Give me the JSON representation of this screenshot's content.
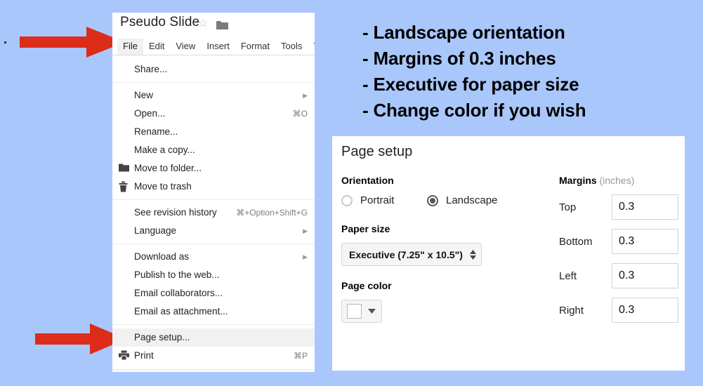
{
  "slide": {
    "background_color": "#aac7fc",
    "arrow_color": "#dd2c1a"
  },
  "instructions": {
    "lines": [
      "- Landscape orientation",
      "- Margins of 0.3 inches",
      "- Executive for paper size",
      "- Change color if you wish"
    ]
  },
  "docs_window": {
    "doc_title": "Pseudo Slide",
    "menubar": [
      {
        "label": "File",
        "active": true
      },
      {
        "label": "Edit",
        "active": false
      },
      {
        "label": "View",
        "active": false
      },
      {
        "label": "Insert",
        "active": false
      },
      {
        "label": "Format",
        "active": false
      },
      {
        "label": "Tools",
        "active": false
      },
      {
        "label": "Ta",
        "active": false
      }
    ],
    "file_menu": [
      {
        "type": "item",
        "label": "Share...",
        "accel": "",
        "caret": false,
        "icon": "",
        "hover": false
      },
      {
        "type": "separator"
      },
      {
        "type": "item",
        "label": "New",
        "accel": "",
        "caret": true,
        "icon": "",
        "hover": false
      },
      {
        "type": "item",
        "label": "Open...",
        "accel": "⌘O",
        "caret": false,
        "icon": "",
        "hover": false
      },
      {
        "type": "item",
        "label": "Rename...",
        "accel": "",
        "caret": false,
        "icon": "",
        "hover": false
      },
      {
        "type": "item",
        "label": "Make a copy...",
        "accel": "",
        "caret": false,
        "icon": "",
        "hover": false
      },
      {
        "type": "item",
        "label": "Move to folder...",
        "accel": "",
        "caret": false,
        "icon": "folder-icon",
        "hover": false
      },
      {
        "type": "item",
        "label": "Move to trash",
        "accel": "",
        "caret": false,
        "icon": "trash-icon",
        "hover": false
      },
      {
        "type": "separator"
      },
      {
        "type": "item",
        "label": "See revision history",
        "accel": "⌘+Option+Shift+G",
        "caret": false,
        "icon": "",
        "hover": false
      },
      {
        "type": "item",
        "label": "Language",
        "accel": "",
        "caret": true,
        "icon": "",
        "hover": false
      },
      {
        "type": "separator"
      },
      {
        "type": "item",
        "label": "Download as",
        "accel": "",
        "caret": true,
        "icon": "",
        "hover": false
      },
      {
        "type": "item",
        "label": "Publish to the web...",
        "accel": "",
        "caret": false,
        "icon": "",
        "hover": false
      },
      {
        "type": "item",
        "label": "Email collaborators...",
        "accel": "",
        "caret": false,
        "icon": "",
        "hover": false
      },
      {
        "type": "item",
        "label": "Email as attachment...",
        "accel": "",
        "caret": false,
        "icon": "",
        "hover": false
      },
      {
        "type": "separator"
      },
      {
        "type": "item",
        "label": "Page setup...",
        "accel": "",
        "caret": false,
        "icon": "",
        "hover": true
      },
      {
        "type": "item",
        "label": "Print",
        "accel": "⌘P",
        "caret": false,
        "icon": "printer-icon",
        "hover": false
      }
    ]
  },
  "page_setup_dialog": {
    "title": "Page setup",
    "orientation": {
      "heading": "Orientation",
      "options": [
        {
          "label": "Portrait",
          "selected": false
        },
        {
          "label": "Landscape",
          "selected": true
        }
      ]
    },
    "paper_size": {
      "heading": "Paper size",
      "selected": "Executive (7.25\" x 10.5\")"
    },
    "page_color": {
      "heading": "Page color",
      "selected_color": "#ffffff"
    },
    "margins": {
      "heading": "Margins",
      "heading_unit": "(inches)",
      "fields": [
        {
          "label": "Top",
          "value": "0.3"
        },
        {
          "label": "Bottom",
          "value": "0.3"
        },
        {
          "label": "Left",
          "value": "0.3"
        },
        {
          "label": "Right",
          "value": "0.3"
        }
      ]
    }
  }
}
